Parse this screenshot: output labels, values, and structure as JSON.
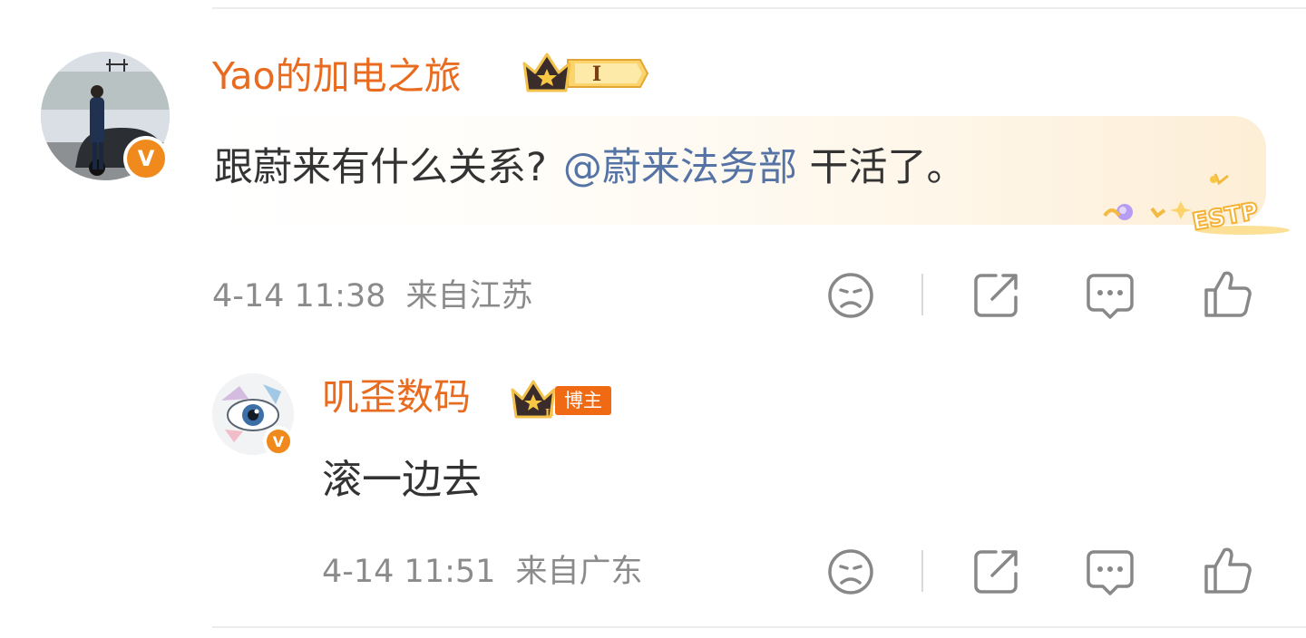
{
  "comments": [
    {
      "username": "Yao的加电之旅",
      "badge_level": "I",
      "text_before": "跟蔚来有什么关系?",
      "mention": "@蔚来法务部",
      "text_after": " 干活了。",
      "personality_tag": "ESTP",
      "time": "4-14 11:38",
      "location": "来自江苏"
    },
    {
      "username": "叽歪数码",
      "badge_level": "II",
      "badge_tag": "博主",
      "text": "滚一边去",
      "time": "4-14 11:51",
      "location": "来自广东"
    }
  ],
  "icons": {
    "dislike": "sad-face-icon",
    "share": "share-icon",
    "reply": "comment-icon",
    "like": "thumbs-up-icon",
    "verified": "verified-v-icon",
    "crown": "crown-icon"
  },
  "colors": {
    "username": "#e86b1f",
    "mention": "#5573a4",
    "meta": "#8b8b8b",
    "verified_badge": "#f08a1c",
    "blogger_tag": "#f06a14"
  }
}
